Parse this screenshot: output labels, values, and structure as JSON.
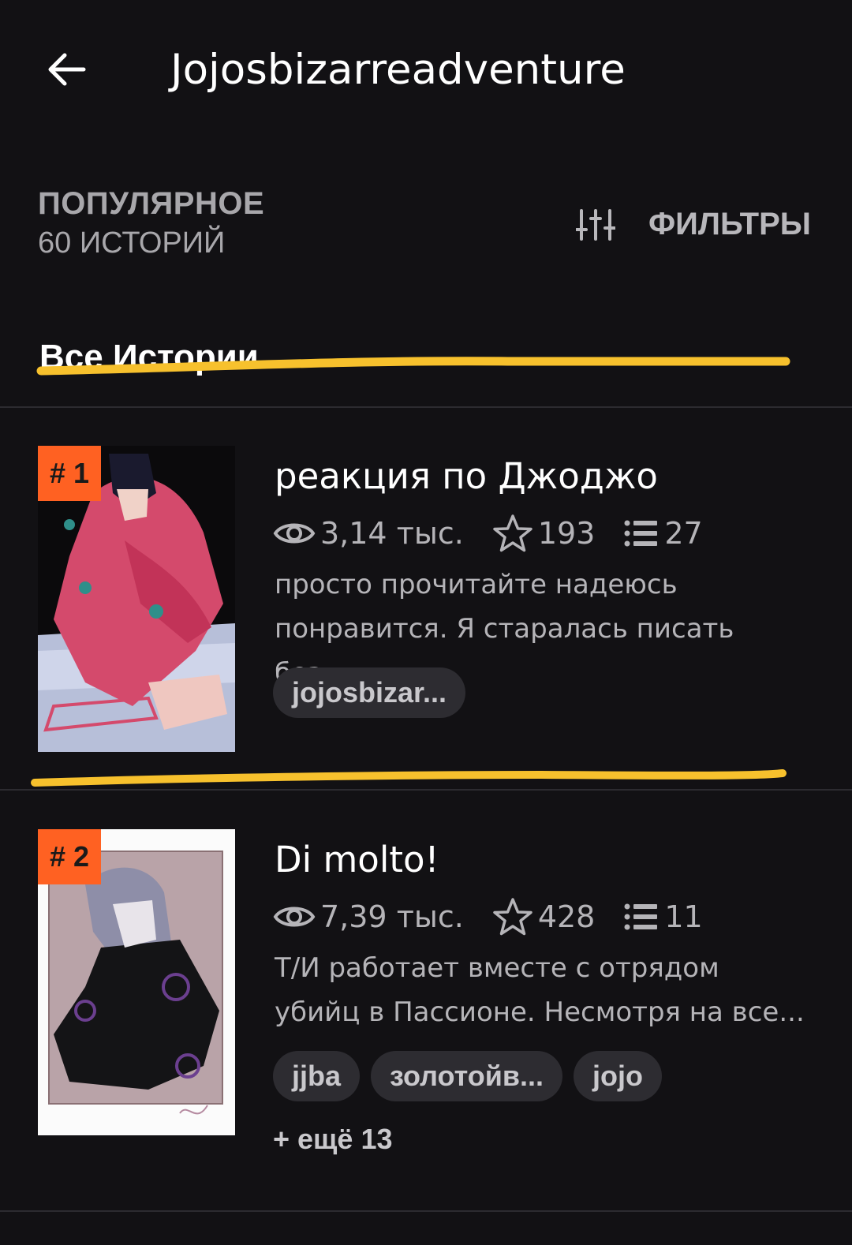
{
  "header": {
    "title": "Jojosbizarreadventure",
    "back_icon": "arrow-left-icon"
  },
  "sort": {
    "label": "ПОПУЛЯРНОЕ",
    "count": "60 ИСТОРИЙ"
  },
  "filters": {
    "icon": "sliders-icon",
    "label": "ФИЛЬТРЫ"
  },
  "section": {
    "title": "Все Истории",
    "highlight_color": "#f7c12d"
  },
  "colors": {
    "background": "#121114",
    "rank_badge": "#ff6122",
    "tag_bg": "#2d2c31"
  },
  "stories": [
    {
      "rank": "# 1",
      "title": "реакция по Джоджо",
      "views": "3,14 тыс.",
      "votes": "193",
      "parts": "27",
      "description_line1": "просто прочитайте надеюсь",
      "description_line2": "понравится. Я старалась писать без...",
      "tags": [
        "jojosbizar..."
      ]
    },
    {
      "rank": "# 2",
      "title": "Di molto!",
      "views": "7,39 тыс.",
      "votes": "428",
      "parts": "11",
      "description_line1": "Т/И работает вместе с отрядом",
      "description_line2": "убийц в Пассионе. Несмотря на все...",
      "tags": [
        "jjba",
        "золотойв...",
        "jojo"
      ],
      "more_tags": "+ ещё 13"
    }
  ]
}
